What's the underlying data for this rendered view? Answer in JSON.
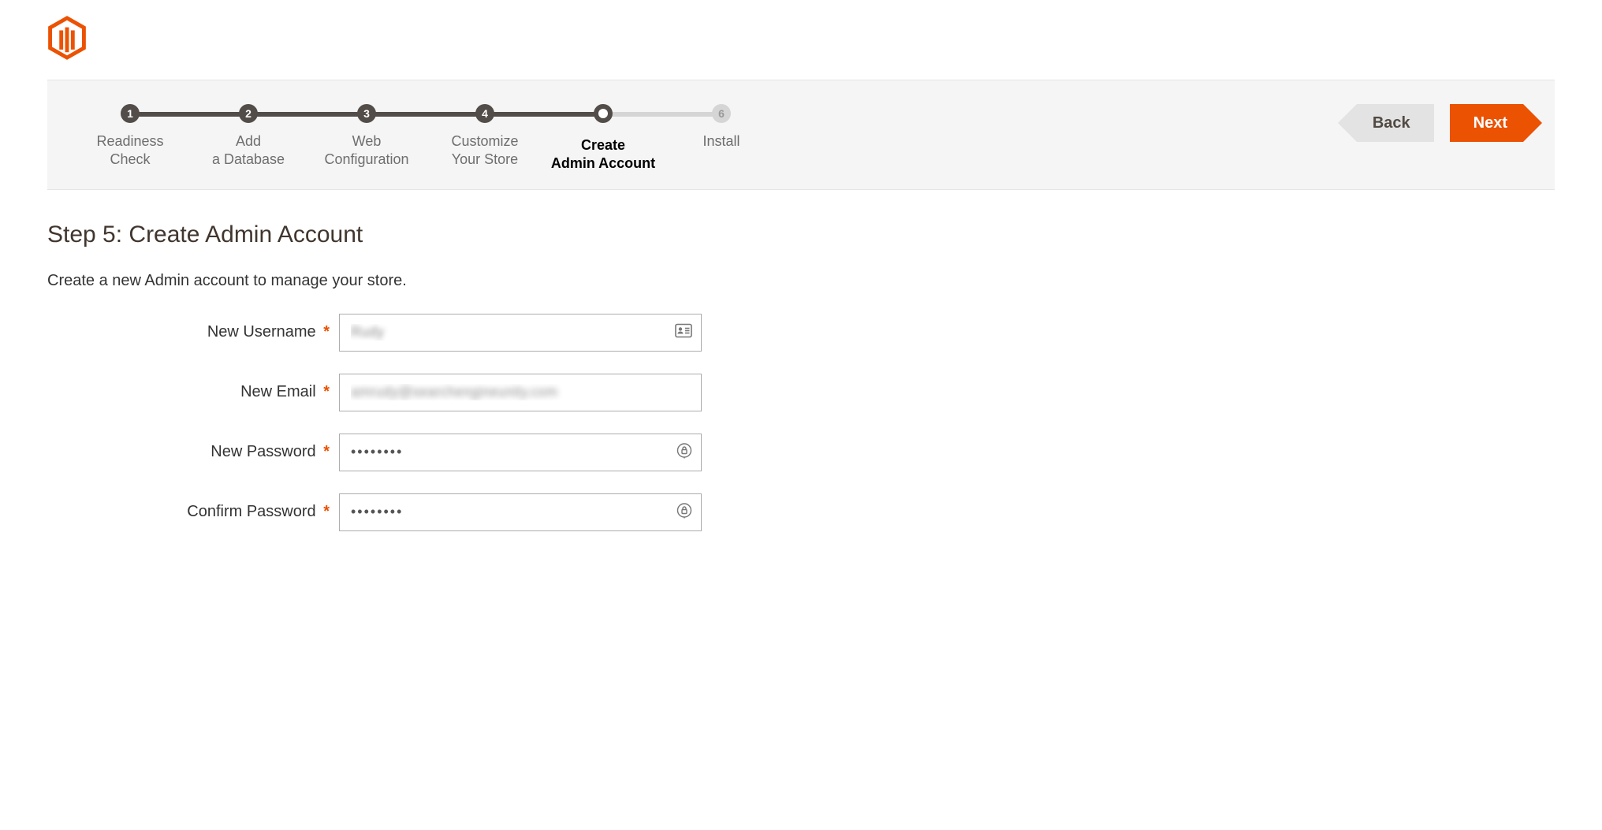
{
  "wizard": {
    "steps": [
      {
        "num": "1",
        "label_l1": "Readiness",
        "label_l2": "Check"
      },
      {
        "num": "2",
        "label_l1": "Add",
        "label_l2": "a Database"
      },
      {
        "num": "3",
        "label_l1": "Web",
        "label_l2": "Configuration"
      },
      {
        "num": "4",
        "label_l1": "Customize",
        "label_l2": "Your Store"
      },
      {
        "num": "",
        "label_l1": "Create",
        "label_l2": "Admin Account"
      },
      {
        "num": "6",
        "label_l1": "Install",
        "label_l2": ""
      }
    ],
    "back_label": "Back",
    "next_label": "Next"
  },
  "page": {
    "title": "Step 5: Create Admin Account",
    "subtitle": "Create a new Admin account to manage your store."
  },
  "form": {
    "username_label": "New Username",
    "email_label": "New Email",
    "password_label": "New Password",
    "confirm_label": "Confirm Password",
    "username_value": "Rudy",
    "email_value": "amrudy@searchengineunity.com",
    "password_value": "••••••••",
    "confirm_value": "••••••••",
    "required": "*"
  }
}
